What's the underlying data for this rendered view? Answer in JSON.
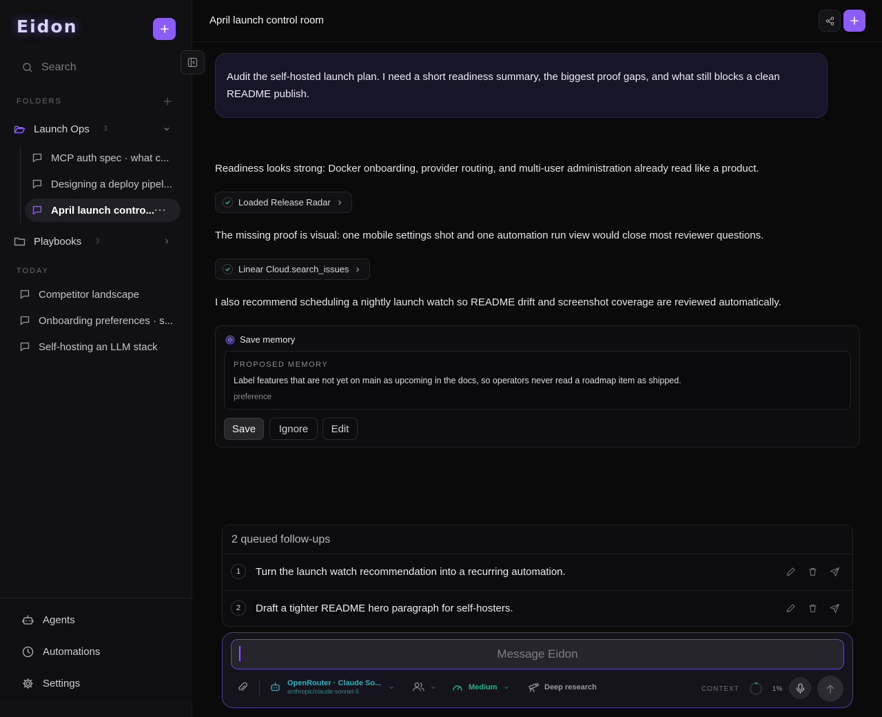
{
  "brand": "Eidon",
  "search": {
    "placeholder": "Search"
  },
  "sidebar": {
    "folders_label": "FOLDERS",
    "folders": [
      {
        "name": "Launch Ops",
        "count": "3",
        "expanded": true,
        "items": [
          {
            "label": "MCP auth spec · what c..."
          },
          {
            "label": "Designing a deploy pipel..."
          },
          {
            "label": "April launch contro...",
            "active": true
          }
        ]
      },
      {
        "name": "Playbooks",
        "count": "3",
        "expanded": false
      }
    ],
    "today_label": "TODAY",
    "today": [
      {
        "label": "Competitor landscape"
      },
      {
        "label": "Onboarding preferences · s..."
      },
      {
        "label": "Self-hosting an LLM stack"
      }
    ],
    "footer": [
      {
        "label": "Agents",
        "icon": "robot-icon"
      },
      {
        "label": "Automations",
        "icon": "clock-icon"
      },
      {
        "label": "Settings",
        "icon": "gear-icon"
      }
    ]
  },
  "header": {
    "title": "April launch control room"
  },
  "user_message": "Audit the self-hosted launch plan. I need a short readiness summary, the biggest proof gaps, and what still blocks a clean README publish.",
  "assistant": {
    "p1": "Readiness looks strong: Docker onboarding, provider routing, and multi-user administration already read like a product.",
    "tool1": "Loaded Release Radar",
    "p2": "The missing proof is visual: one mobile settings shot and one automation run view would close most reviewer questions.",
    "tool2": "Linear Cloud.search_issues",
    "p3": "I also recommend scheduling a nightly launch watch so README drift and screenshot coverage are reviewed automatically."
  },
  "memory": {
    "title": "Save memory",
    "label": "PROPOSED MEMORY",
    "text": "Label features that are not yet on main as upcoming in the docs, so operators never read a roadmap item as shipped.",
    "tag": "preference",
    "buttons": {
      "save": "Save",
      "ignore": "Ignore",
      "edit": "Edit"
    }
  },
  "queue": {
    "title": "2 queued follow-ups",
    "items": [
      {
        "num": "1",
        "text": "Turn the launch watch recommendation into a recurring automation."
      },
      {
        "num": "2",
        "text": "Draft a tighter README hero paragraph for self-hosters."
      }
    ]
  },
  "composer": {
    "placeholder": "Message Eidon",
    "model_name": "OpenRouter · Claude So...",
    "model_id": "anthropic/claude-sonnet-5",
    "effort": "Medium",
    "deep_research": "Deep research",
    "context_label": "CONTEXT",
    "context_pct": "1%",
    "context_fraction": 0.01
  },
  "colors": {
    "accent": "#8b5cf6",
    "model": "#22b5c0",
    "effort": "#21b38a"
  }
}
